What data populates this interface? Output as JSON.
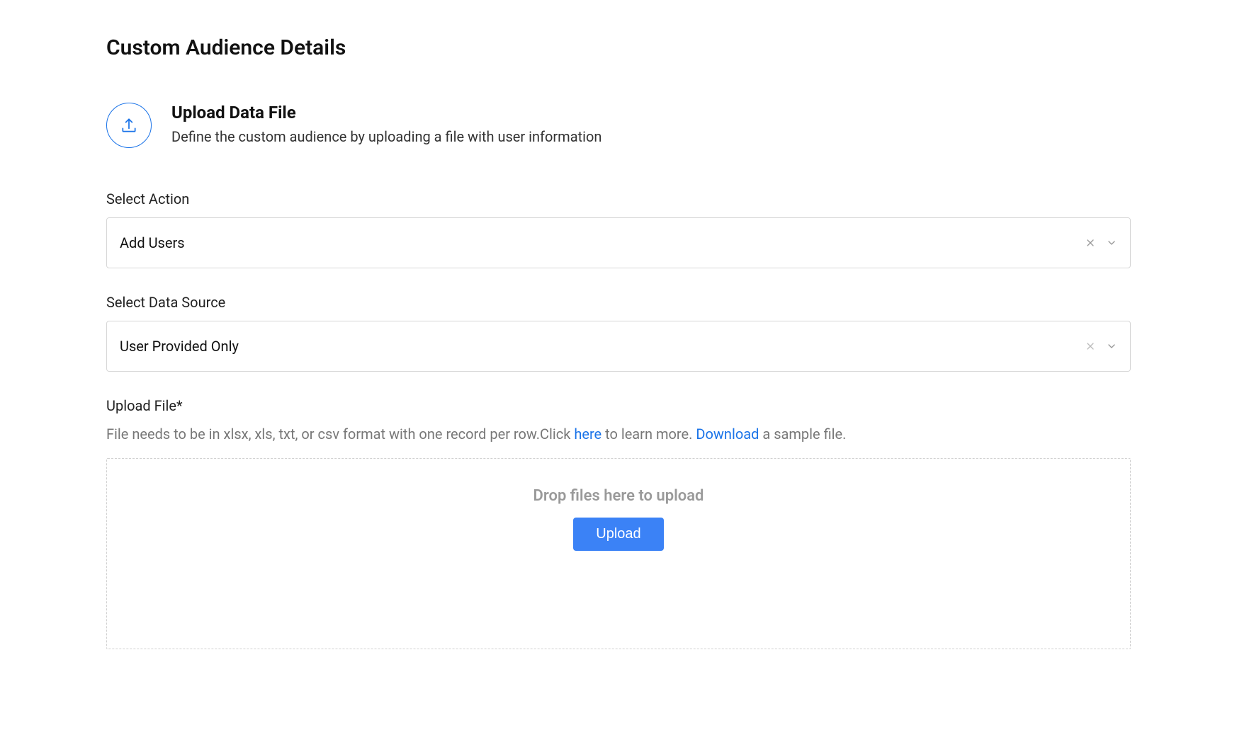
{
  "page": {
    "title": "Custom Audience Details"
  },
  "upload_section": {
    "heading": "Upload Data File",
    "description": "Define the custom audience by uploading a file with user information"
  },
  "fields": {
    "action": {
      "label": "Select Action",
      "value": "Add Users"
    },
    "data_source": {
      "label": "Select Data Source",
      "value": "User Provided Only"
    },
    "upload_file": {
      "label": "Upload File*",
      "help_prefix": "File needs to be in xlsx, xls, txt, or csv format with one record per row.Click ",
      "help_link1": "here",
      "help_mid": " to learn more. ",
      "help_link2": "Download",
      "help_suffix": " a sample file."
    }
  },
  "dropzone": {
    "text": "Drop files here to upload",
    "button": "Upload"
  }
}
